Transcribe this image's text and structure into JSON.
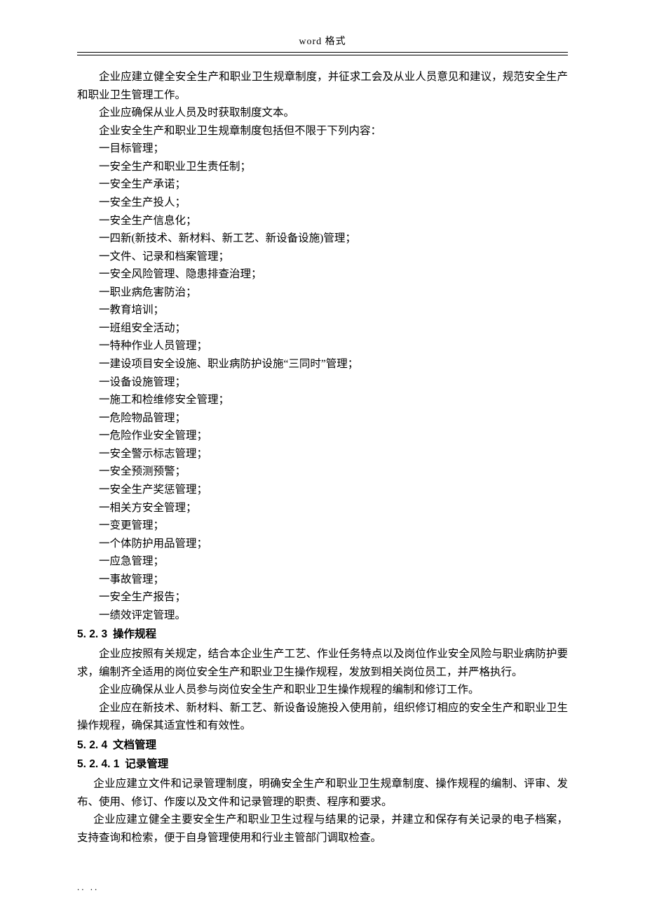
{
  "header": {
    "label": "word 格式"
  },
  "body": {
    "para_intro_1": "企业应建立健全安全生产和职业卫生规章制度，并征求工会及从业人员意见和建议，规范安全生产和职业卫生管理工作。",
    "para_intro_2": "企业应确保从业人员及时获取制度文本。",
    "para_intro_3": "企业安全生产和职业卫生规章制度包括但不限于下列内容：",
    "list_items": [
      "一目标管理；",
      "一安全生产和职业卫生责任制；",
      "一安全生产承诺；",
      "一安全生产投人；",
      "一安全生产信息化；",
      "一四新(新技术、新材料、新工艺、新设备设施)管理；",
      "一文件、记录和档案管理；",
      "一安全风险管理、隐患排查治理；",
      "一职业病危害防治；",
      "一教育培训；",
      "一班组安全活动；",
      "一特种作业人员管理；",
      "一建设项目安全设施、职业病防护设施“三同时”管理；",
      "一设备设施管理；",
      "一施工和检维修安全管理；",
      "一危险物品管理；",
      "一危险作业安全管理；",
      "一安全警示标志管理；",
      "一安全预测预警；",
      "一安全生产奖惩管理；",
      "一相关方安全管理；",
      "一变更管理；",
      "一个体防护用品管理；",
      "一应急管理；",
      "一事故管理；",
      "一安全生产报告；",
      "一绩效评定管理。"
    ],
    "h_523_num": "5. 2. 3",
    "h_523_title": "操作规程",
    "para_523_1": "企业应按照有关规定，结合本企业生产工艺、作业任务特点以及岗位作业安全风险与职业病防护要求，编制齐全适用的岗位安全生产和职业卫生操作规程，发放到相关岗位员工，并严格执行。",
    "para_523_2": "企业应确保从业人员参与岗位安全生产和职业卫生操作规程的编制和修订工作。",
    "para_523_3": "企业应在新技术、新材料、新工艺、新设备设施投入使用前，组织修订相应的安全生产和职业卫生操作规程，确保其适宜性和有效性。",
    "h_524_num": "5. 2. 4",
    "h_524_title": "文档管理",
    "h_5241_num": "5. 2. 4. 1",
    "h_5241_title": "记录管理",
    "para_5241_1": "企业应建立文件和记录管理制度，明确安全生产和职业卫生规章制度、操作规程的编制、评审、发布、使用、修订、作废以及文件和记录管理的职责、程序和要求。",
    "para_5241_2": "企业应建立健全主要安全生产和职业卫生过程与结果的记录，并建立和保存有关记录的电子档案，支持查询和检索，便于自身管理使用和行业主管部门调取检查。"
  },
  "footer": {
    "dots": "..  .."
  }
}
